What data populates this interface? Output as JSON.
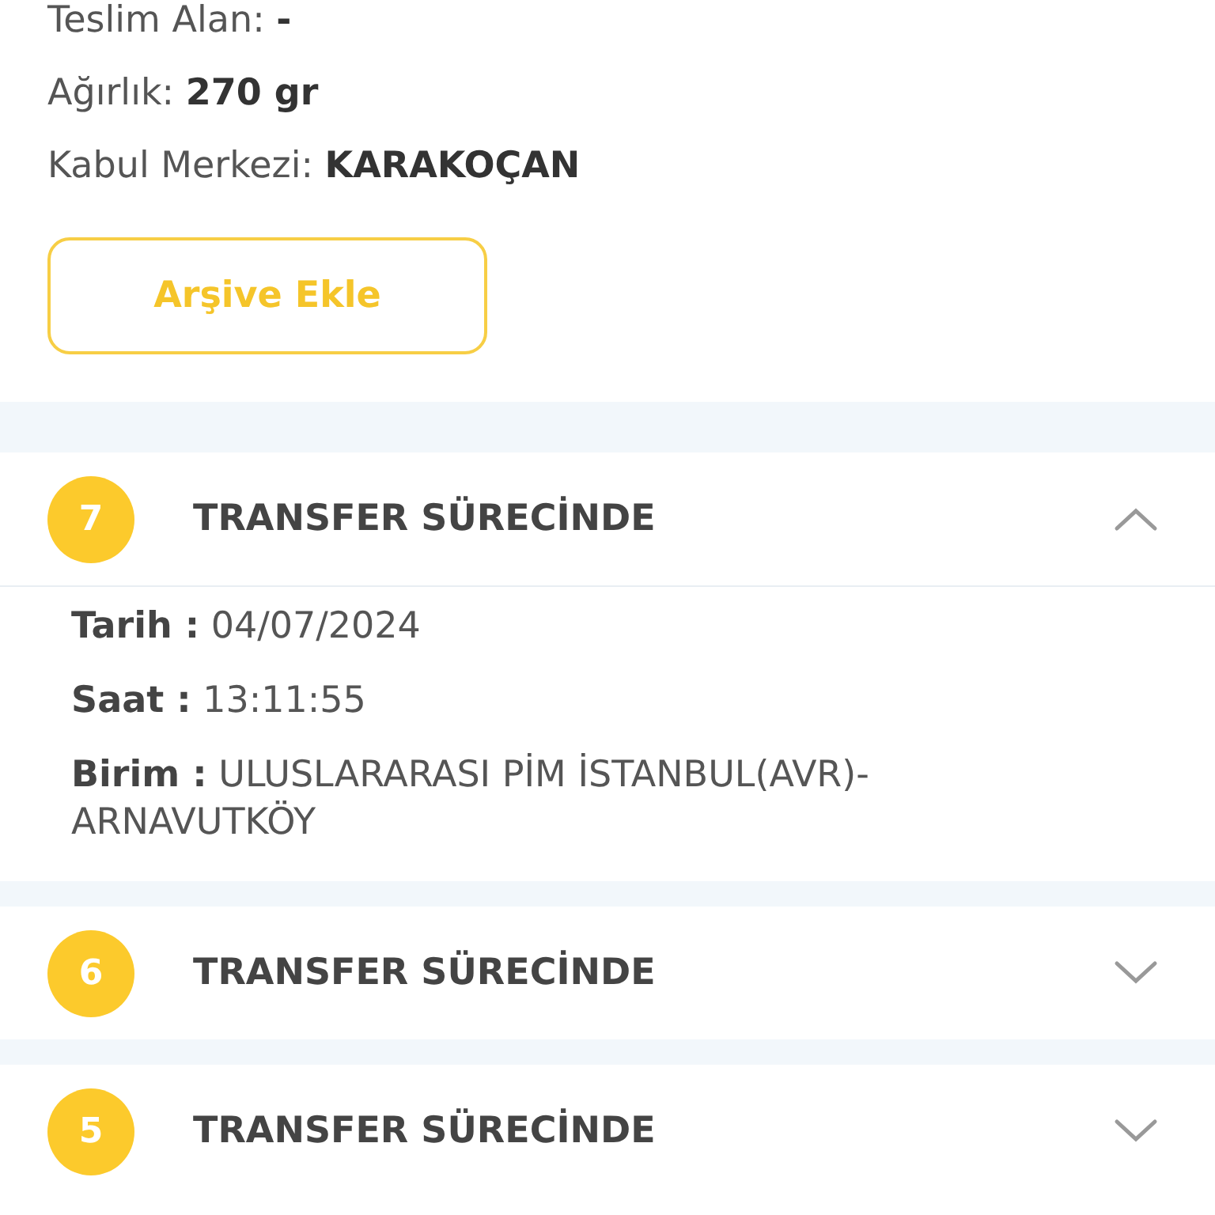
{
  "info": [
    {
      "label": "Teslim Alan:",
      "value": "-"
    },
    {
      "label": "Ağırlık:",
      "value": "270 gr"
    },
    {
      "label": "Kabul Merkezi:",
      "value": "KARAKOÇAN"
    }
  ],
  "archive_button": "Arşive Ekle",
  "steps": [
    {
      "number": "7",
      "title": "TRANSFER SÜRECİNDE",
      "expanded": true,
      "details": [
        {
          "label": "Tarih :",
          "value": "04/07/2024"
        },
        {
          "label": "Saat :",
          "value": "13:11:55"
        },
        {
          "label": "Birim :",
          "value": "ULUSLARARASI PİM İSTANBUL(AVR)-ARNAVUTKÖY"
        }
      ]
    },
    {
      "number": "6",
      "title": "TRANSFER SÜRECİNDE",
      "expanded": false
    },
    {
      "number": "5",
      "title": "TRANSFER SÜRECİNDE",
      "expanded": false
    }
  ]
}
